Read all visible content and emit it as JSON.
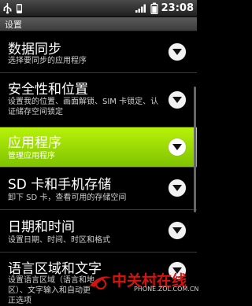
{
  "status_bar": {
    "time": "23:08",
    "icons": [
      "usb-icon",
      "phone-icon",
      "signal-icon",
      "battery-icon"
    ]
  },
  "title_bar": {
    "title": "设置"
  },
  "settings": [
    {
      "title": "数据同步",
      "summary": "选择要同步的应用程序",
      "selected": false
    },
    {
      "title": "安全性和位置",
      "summary": "设置我的位置、画面解锁、SIM 卡锁定、认证储存空间锁定",
      "selected": false
    },
    {
      "title": "应用程序",
      "summary": "管理应用程序",
      "selected": true
    },
    {
      "title": "SD 卡和手机存储",
      "summary": "卸下 SD 卡，查看可用的存储空间",
      "selected": false
    },
    {
      "title": "日期和时间",
      "summary": "设置日期、时间、时区和格式",
      "selected": false
    },
    {
      "title": "语言区域和文字",
      "summary": "设置语言区域（语言和地区）、文字输入和自动更正选项",
      "selected": false
    }
  ],
  "watermark": {
    "text": "中关村在线",
    "url": "PHONE.ZOL.COM.CN"
  },
  "colors": {
    "selected_bg": "#9fdc05",
    "background": "#000000",
    "watermark": "#d8120f"
  }
}
